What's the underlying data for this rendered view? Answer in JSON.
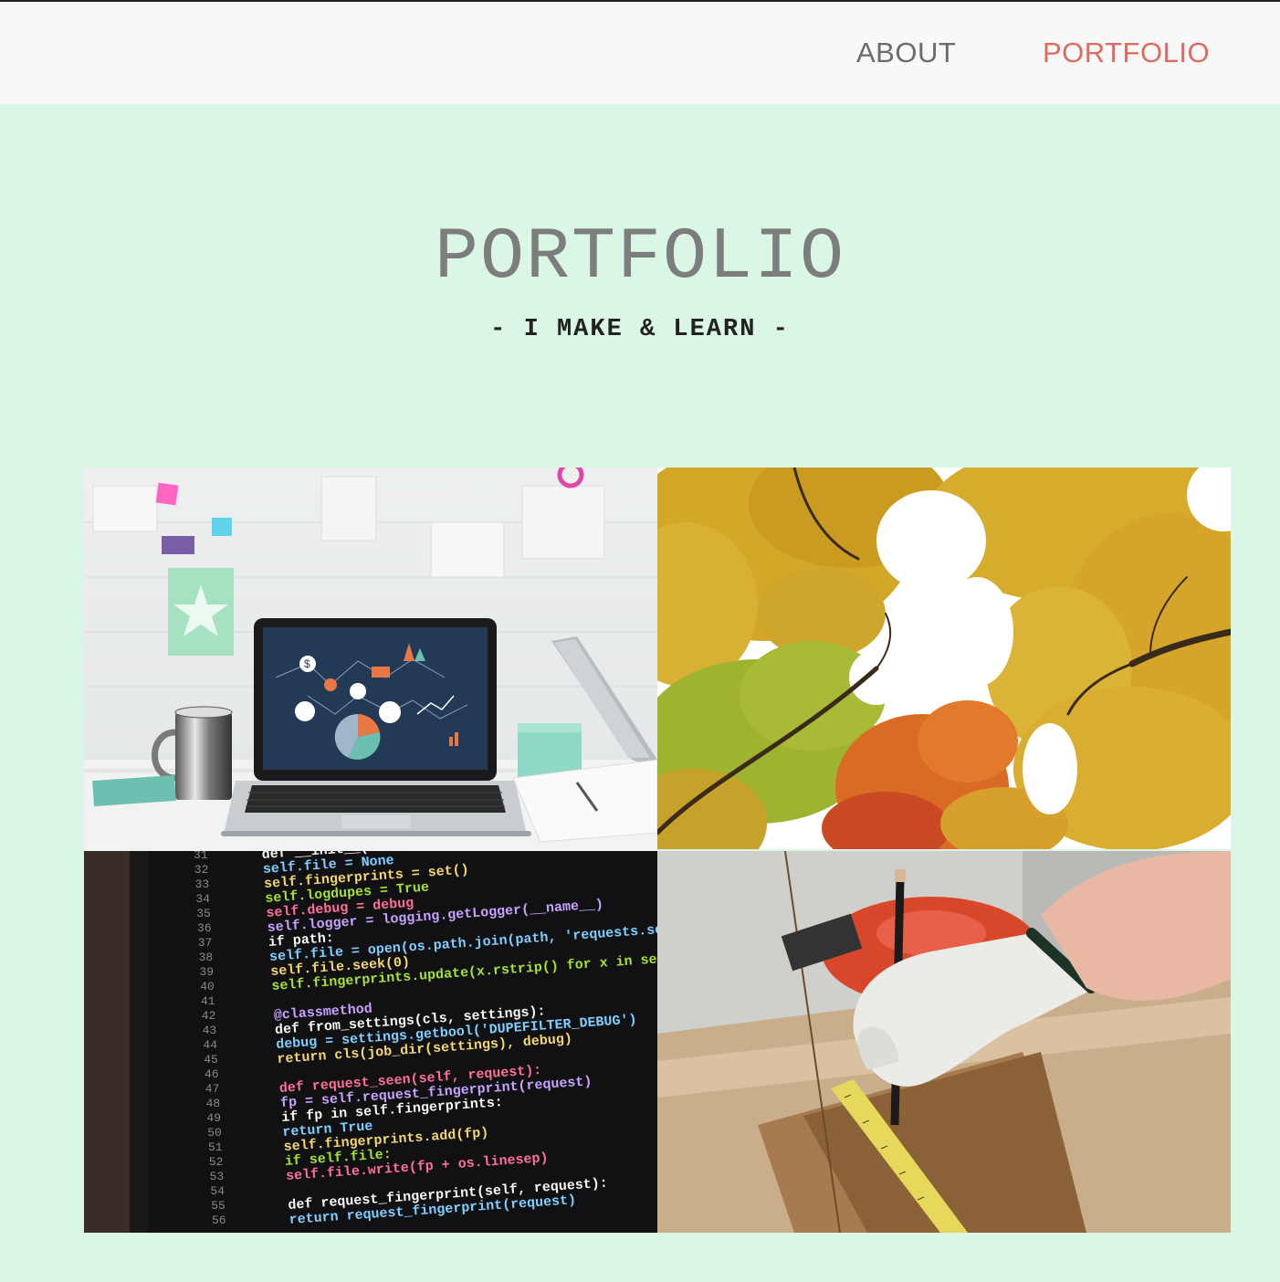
{
  "nav": {
    "about_label": "ABOUT",
    "portfolio_label": "PORTFOLIO",
    "active_color": "#e06a5f"
  },
  "hero": {
    "title": "PORTFOLIO",
    "subtitle": "- I MAKE & LEARN -"
  },
  "colors": {
    "page_background": "#d9f7e4",
    "navbar_background": "#f8f8f8"
  },
  "portfolio": {
    "tiles": [
      {
        "subject": "laptop-workspace"
      },
      {
        "subject": "autumn-trees"
      },
      {
        "subject": "code-screen"
      },
      {
        "subject": "woodworking-measure"
      }
    ]
  },
  "code_screen": {
    "line_numbers": [
      "31",
      "32",
      "33",
      "34",
      "35",
      "36",
      "37",
      "38",
      "39",
      "40",
      "41",
      "42",
      "43",
      "44",
      "45",
      "46",
      "47",
      "48",
      "49",
      "50",
      "51",
      "52",
      "53",
      "54",
      "55",
      "56"
    ],
    "lines": [
      "def __init__(self, path=None,",
      "    self.file = None",
      "    self.fingerprints = set()",
      "    self.logdupes = True",
      "    self.debug = debug",
      "    self.logger = logging.getLogger(__name__)",
      "    if path:",
      "        self.file = open(os.path.join(path, 'requests.seen'),",
      "        self.file.seek(0)",
      "        self.fingerprints.update(x.rstrip() for x in self.file)",
      "",
      "@classmethod",
      "def from_settings(cls, settings):",
      "    debug = settings.getbool('DUPEFILTER_DEBUG')",
      "    return cls(job_dir(settings), debug)",
      "",
      "def request_seen(self, request):",
      "    fp = self.request_fingerprint(request)",
      "    if fp in self.fingerprints:",
      "        return True",
      "    self.fingerprints.add(fp)",
      "    if self.file:",
      "        self.file.write(fp + os.linesep)",
      "",
      "def request_fingerprint(self, request):",
      "    return request_fingerprint(request)"
    ]
  }
}
